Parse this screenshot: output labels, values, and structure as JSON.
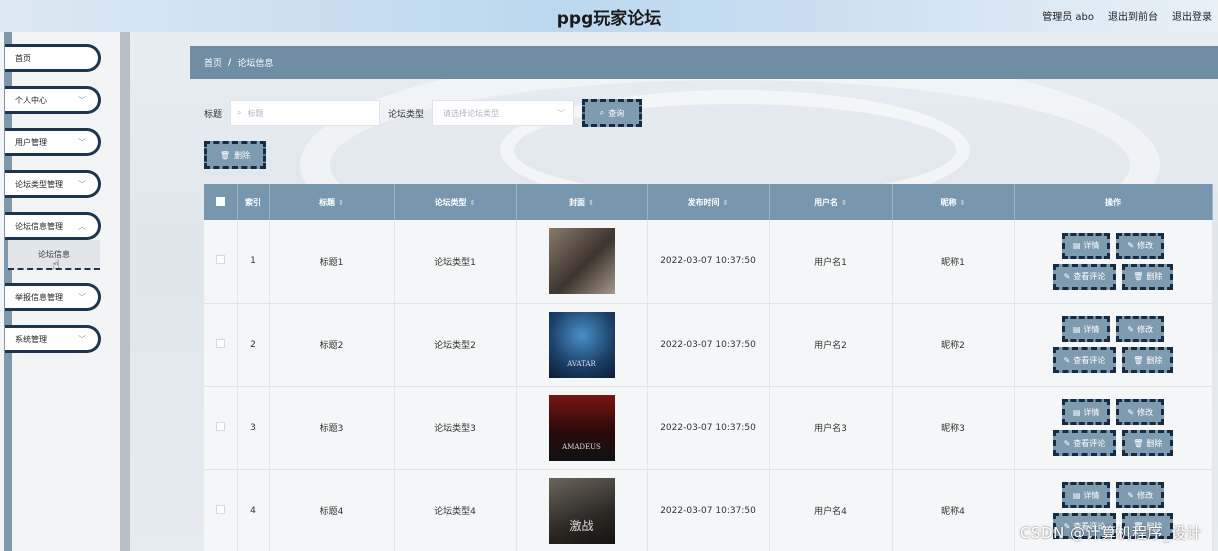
{
  "header": {
    "title": "ppg玩家论坛",
    "links": [
      "管理员 abo",
      "退出到前台",
      "退出登录"
    ]
  },
  "sidebar": {
    "items": [
      {
        "label": "首页",
        "has_chevron": false
      },
      {
        "label": "个人中心",
        "has_chevron": true
      },
      {
        "label": "用户管理",
        "has_chevron": true
      },
      {
        "label": "论坛类型管理",
        "has_chevron": true
      },
      {
        "label": "论坛信息管理",
        "has_chevron": true
      },
      {
        "label": "举报信息管理",
        "has_chevron": true
      },
      {
        "label": "系统管理",
        "has_chevron": true
      }
    ],
    "active_sub": "论坛信息"
  },
  "breadcrumb": {
    "home": "首页",
    "sep": "/",
    "current": "论坛信息"
  },
  "search": {
    "title_label": "标题",
    "title_placeholder": "标题",
    "type_label": "论坛类型",
    "type_placeholder": "请选择论坛类型",
    "query_button": "查询"
  },
  "actions": {
    "delete_button": "删除"
  },
  "table": {
    "columns": [
      "索引",
      "标题",
      "论坛类型",
      "封面",
      "发布时间",
      "用户名",
      "昵称",
      "操作"
    ],
    "rows": [
      {
        "index": "1",
        "title": "标题1",
        "type": "论坛类型1",
        "cover_caption": "",
        "time": "2022-03-07 10:37:50",
        "username": "用户名1",
        "nickname": "昵称1"
      },
      {
        "index": "2",
        "title": "标题2",
        "type": "论坛类型2",
        "cover_caption": "AVATAR",
        "time": "2022-03-07 10:37:50",
        "username": "用户名2",
        "nickname": "昵称2"
      },
      {
        "index": "3",
        "title": "标题3",
        "type": "论坛类型3",
        "cover_caption": "AMADEUS",
        "time": "2022-03-07 10:37:50",
        "username": "用户名3",
        "nickname": "昵称3"
      },
      {
        "index": "4",
        "title": "标题4",
        "type": "论坛类型4",
        "cover_caption": "激战",
        "time": "2022-03-07 10:37:50",
        "username": "用户名4",
        "nickname": "昵称4"
      }
    ],
    "op_labels": {
      "detail": "详情",
      "edit": "修改",
      "comments": "查看评论",
      "delete": "删除"
    }
  },
  "watermark": "CSDN @计算机程序_设计",
  "colors": {
    "accent": "#7896ad",
    "dark_border": "#162c44",
    "band": "#6f8ea4"
  }
}
